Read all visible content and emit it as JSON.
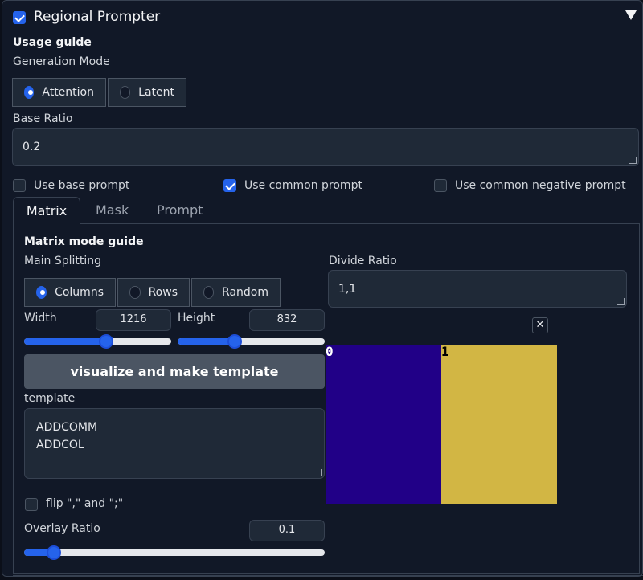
{
  "header": {
    "enable_checked": true,
    "title": "Regional Prompter",
    "collapse_icon": "triangle-down-icon"
  },
  "usage_guide": "Usage guide",
  "generation_mode": {
    "label": "Generation Mode",
    "options": [
      "Attention",
      "Latent"
    ],
    "selected": "Attention"
  },
  "base_ratio": {
    "label": "Base Ratio",
    "value": "0.2"
  },
  "checkboxes": {
    "use_base_prompt": {
      "label": "Use base prompt",
      "checked": false
    },
    "use_common_prompt": {
      "label": "Use common prompt",
      "checked": true
    },
    "use_common_negative_prompt": {
      "label": "Use common negative prompt",
      "checked": false
    }
  },
  "tabs": [
    "Matrix",
    "Mask",
    "Prompt"
  ],
  "active_tab": "Matrix",
  "matrix": {
    "guide": "Matrix mode guide",
    "main_splitting": {
      "label": "Main Splitting",
      "options": [
        "Columns",
        "Rows",
        "Random"
      ],
      "selected": "Columns"
    },
    "divide_ratio": {
      "label": "Divide Ratio",
      "value": "1,1"
    },
    "width": {
      "label": "Width",
      "value": "1216",
      "slider_fraction": 0.56
    },
    "height": {
      "label": "Height",
      "value": "832",
      "slider_fraction": 0.39
    },
    "visualize_button": "visualize and make template",
    "template": {
      "label": "template",
      "lines": [
        "ADDCOMM",
        "ADDCOL"
      ]
    },
    "flip": {
      "label": "flip \",\" and \";\"",
      "checked": false
    },
    "overlay_ratio": {
      "label": "Overlay Ratio",
      "value": "0.1",
      "slider_fraction": 0.1
    },
    "preview": {
      "close_icon": "close-icon",
      "regions": [
        {
          "label": "0",
          "color": "#210087"
        },
        {
          "label": "1",
          "color": "#d2b644"
        }
      ]
    }
  },
  "colors": {
    "accent": "#2563eb",
    "background": "#0b0f19",
    "panel": "#111827"
  }
}
